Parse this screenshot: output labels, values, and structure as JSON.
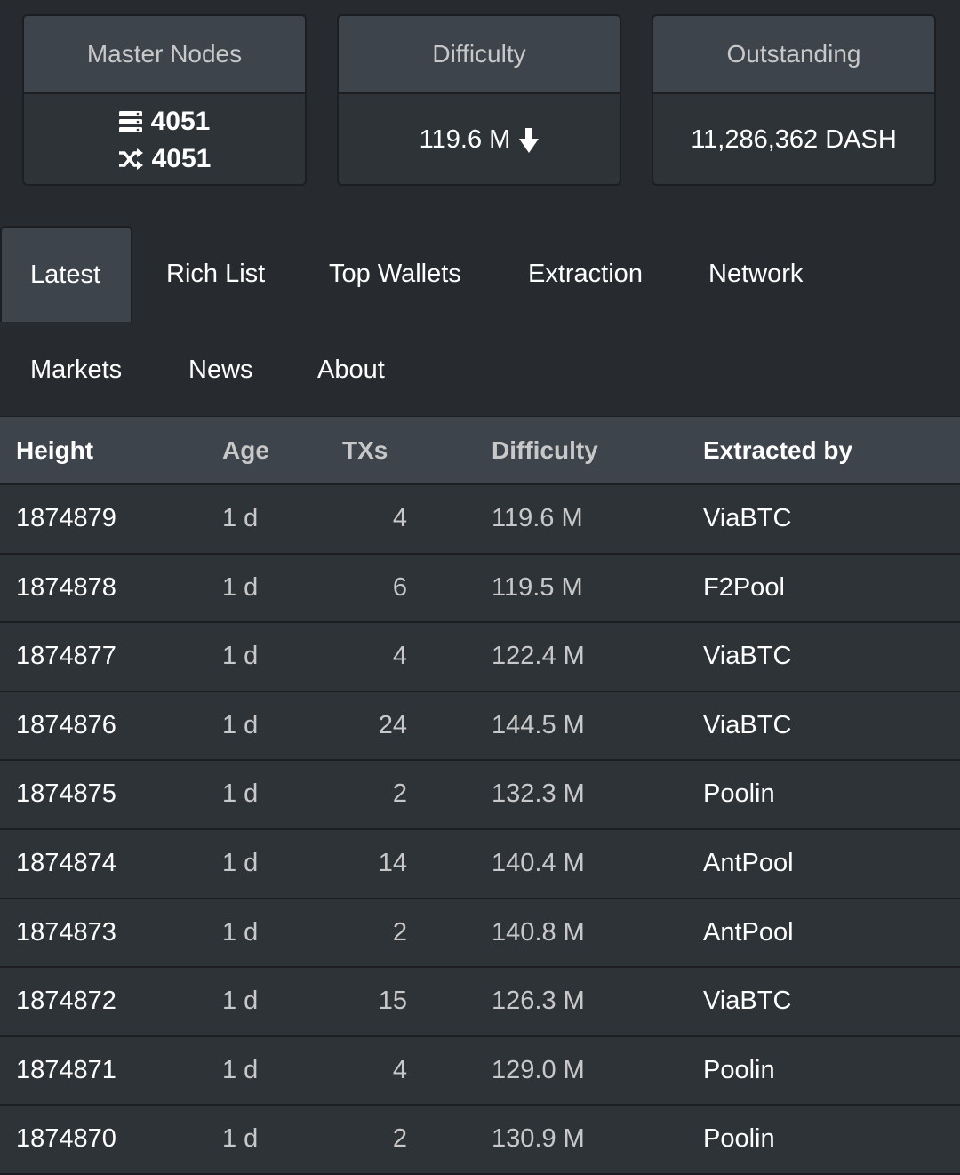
{
  "cards": {
    "masternodes": {
      "title": "Master Nodes",
      "enabled": "4051",
      "total": "4051"
    },
    "difficulty": {
      "title": "Difficulty",
      "value": "119.6 M",
      "trend_icon": "arrow-down-icon"
    },
    "outstanding": {
      "title": "Outstanding",
      "value": "11,286,362 DASH"
    }
  },
  "nav": {
    "tabs": [
      {
        "label": "Latest",
        "active": true
      },
      {
        "label": "Rich List"
      },
      {
        "label": "Top Wallets"
      },
      {
        "label": "Extraction"
      },
      {
        "label": "Network"
      },
      {
        "label": "Markets"
      },
      {
        "label": "News"
      },
      {
        "label": "About"
      }
    ]
  },
  "table": {
    "headers": [
      "Height",
      "Age",
      "TXs",
      "Difficulty",
      "Extracted by"
    ],
    "rows": [
      [
        "1874879",
        "1 d",
        "4",
        "119.6 M",
        "ViaBTC"
      ],
      [
        "1874878",
        "1 d",
        "6",
        "119.5 M",
        "F2Pool"
      ],
      [
        "1874877",
        "1 d",
        "4",
        "122.4 M",
        "ViaBTC"
      ],
      [
        "1874876",
        "1 d",
        "24",
        "144.5 M",
        "ViaBTC"
      ],
      [
        "1874875",
        "1 d",
        "2",
        "132.3 M",
        "Poolin"
      ],
      [
        "1874874",
        "1 d",
        "14",
        "140.4 M",
        "AntPool"
      ],
      [
        "1874873",
        "1 d",
        "2",
        "140.8 M",
        "AntPool"
      ],
      [
        "1874872",
        "1 d",
        "15",
        "126.3 M",
        "ViaBTC"
      ],
      [
        "1874871",
        "1 d",
        "4",
        "129.0 M",
        "Poolin"
      ],
      [
        "1874870",
        "1 d",
        "2",
        "130.9 M",
        "Poolin"
      ]
    ]
  }
}
